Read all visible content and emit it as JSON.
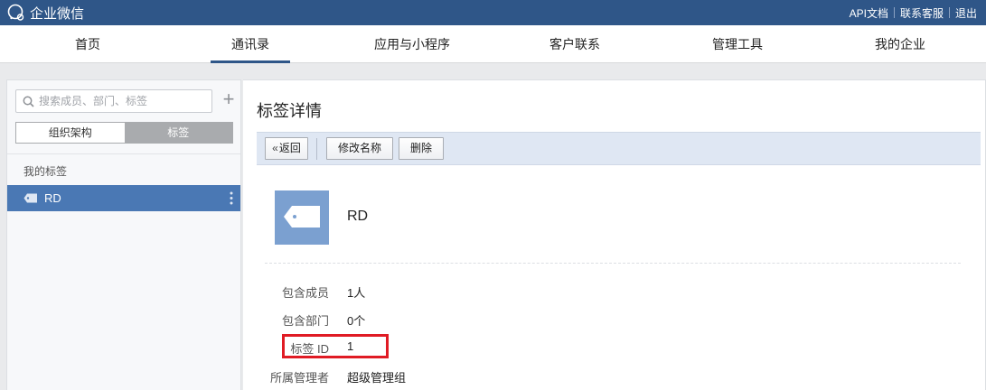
{
  "brand": {
    "name": "企业微信"
  },
  "top_links": [
    "API文档",
    "联系客服",
    "退出"
  ],
  "nav": {
    "items": [
      "首页",
      "通讯录",
      "应用与小程序",
      "客户联系",
      "管理工具",
      "我的企业"
    ],
    "active": "通讯录"
  },
  "sidebar": {
    "search_placeholder": "搜索成员、部门、标签",
    "add_label": "+",
    "tabs": [
      "组织架构",
      "标签"
    ],
    "active_tab": "标签",
    "section_title": "我的标签",
    "tags": [
      {
        "label": "RD",
        "selected": true
      }
    ]
  },
  "detail": {
    "title": "标签详情",
    "toolbar": {
      "back": "返回",
      "rename": "修改名称",
      "delete": "删除"
    },
    "tag_name": "RD",
    "fields": [
      {
        "label": "包含成员",
        "value": "1人"
      },
      {
        "label": "包含部门",
        "value": "0个"
      },
      {
        "label": "标签 ID",
        "value": "1",
        "highlighted": true
      },
      {
        "label": "所属管理者",
        "value": "超级管理组"
      }
    ]
  },
  "colors": {
    "topbar": "#2f5688",
    "selected_item": "#4a78b4",
    "tag_avatar": "#7ba0d0",
    "toolbar_bg": "#dfe7f3",
    "highlight": "#e01b24"
  }
}
